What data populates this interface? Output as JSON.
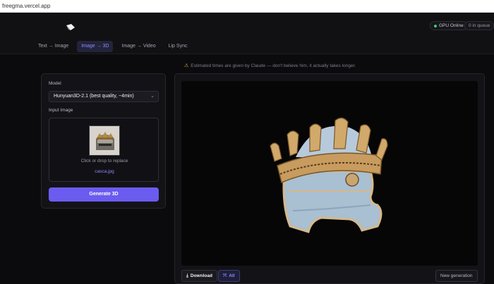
{
  "browser": {
    "url": "freegma.vercel.app"
  },
  "header": {
    "gpu_status": "GPU Online",
    "queue_status": "0 in queue",
    "tabs": [
      {
        "label": "Text → Image",
        "active": false
      },
      {
        "label": "Image → 3D",
        "active": true
      },
      {
        "label": "Image → Video",
        "active": false
      },
      {
        "label": "Lip Sync",
        "active": false
      }
    ]
  },
  "notice": "Estimated times are given by Claude — don't believe him, it actually takes longer.",
  "left_panel": {
    "model_label": "Model",
    "model_value": "Hunyuan3D-2.1 (best quality, ~4min)",
    "input_label": "Input Image",
    "dropzone_text": "Click or drop to replace",
    "file_name": "casca.jpg",
    "generate_label": "Generate 3D"
  },
  "right_panel": {
    "download_label": "Download",
    "all_label": "All",
    "new_generation_label": "New generation"
  },
  "colors": {
    "accent": "#6b5cf0",
    "accent_text": "#8b8bff",
    "status_online": "#3ecf6a",
    "background": "#0b0b0d"
  }
}
